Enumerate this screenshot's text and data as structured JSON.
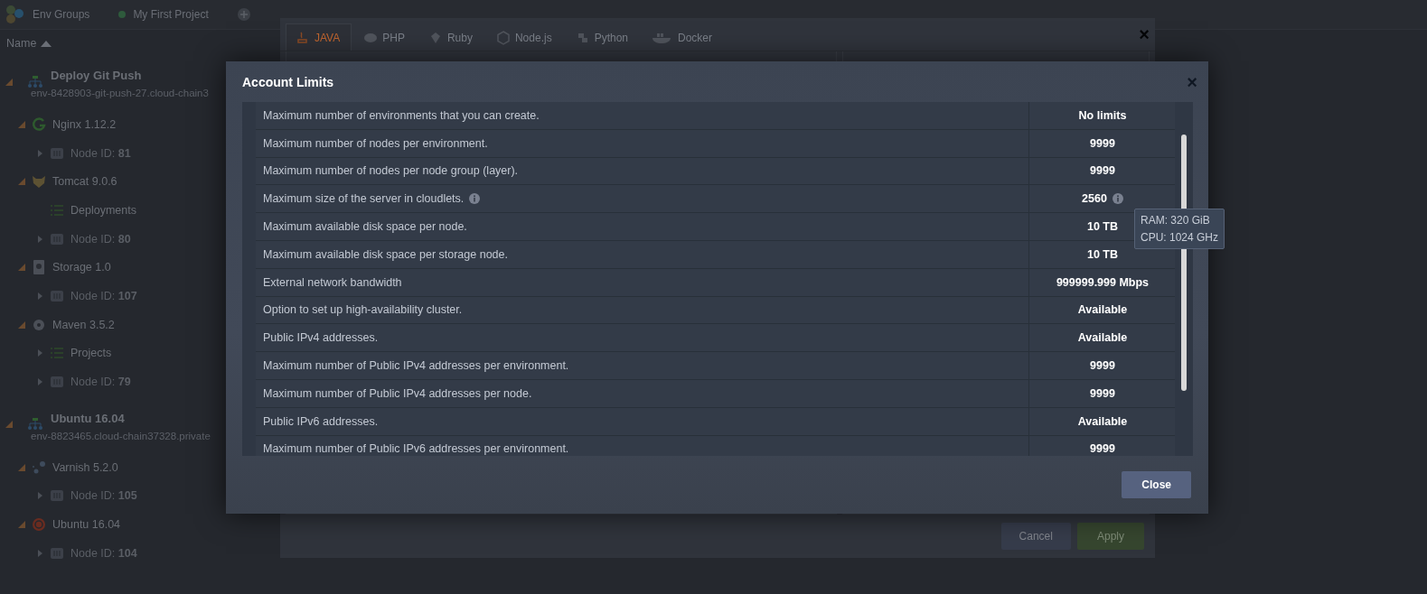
{
  "breadcrumbs": [
    {
      "label": "Env Groups",
      "kind": "groups"
    },
    {
      "label": "My First Project",
      "kind": "project"
    }
  ],
  "tree_header": {
    "label": "Name"
  },
  "tree": [
    {
      "label": "Deploy Git Push",
      "subtitle": "env-8428903-git-push-27.cloud-chain3",
      "kind": "env",
      "expanded": true,
      "children": [
        {
          "label": "Nginx 1.12.2",
          "kind": "nginx",
          "expanded": true,
          "children": [
            {
              "label": "Node ID: **81**",
              "kind": "node",
              "expanded": false
            }
          ]
        },
        {
          "label": "Tomcat 9.0.6",
          "kind": "tomcat",
          "expanded": true,
          "children": [
            {
              "label": "Deployments",
              "kind": "list"
            },
            {
              "label": "Node ID: **80**",
              "kind": "node",
              "expanded": false
            }
          ]
        },
        {
          "label": "Storage 1.0",
          "kind": "storage",
          "expanded": true,
          "children": [
            {
              "label": "Node ID: **107**",
              "kind": "node",
              "expanded": false
            }
          ]
        },
        {
          "label": "Maven 3.5.2",
          "kind": "maven",
          "expanded": true,
          "children": [
            {
              "label": "Projects",
              "kind": "list",
              "expanded": false
            },
            {
              "label": "Node ID: **79**",
              "kind": "node",
              "expanded": false
            }
          ]
        }
      ]
    },
    {
      "label": "Ubuntu 16.04",
      "subtitle": "env-8823465.cloud-chain37328.private",
      "kind": "env",
      "expanded": true,
      "children": [
        {
          "label": "Varnish 5.2.0",
          "kind": "varnish",
          "expanded": true,
          "children": [
            {
              "label": "Node ID: **105**",
              "kind": "node",
              "expanded": false
            }
          ]
        },
        {
          "label": "Ubuntu 16.04",
          "kind": "ubuntu",
          "expanded": true,
          "children": [
            {
              "label": "Node ID: **104**",
              "kind": "node",
              "expanded": false
            }
          ]
        }
      ]
    }
  ],
  "back_dialog": {
    "close": "×",
    "tabs": [
      {
        "label": "JAVA",
        "selected": true
      },
      {
        "label": "PHP",
        "selected": false
      },
      {
        "label": "Ruby",
        "selected": false
      },
      {
        "label": "Node.js",
        "selected": false
      },
      {
        "label": "Python",
        "selected": false
      },
      {
        "label": "Docker",
        "selected": false
      }
    ],
    "buttons": [
      {
        "label": "Cancel",
        "kind": "secondary"
      },
      {
        "label": "Apply",
        "kind": "primary"
      }
    ]
  },
  "modal": {
    "title": "Account Limits",
    "close": "×",
    "rows": [
      {
        "label": "Maximum number of environments that you can create.",
        "value": "No limits"
      },
      {
        "label": "Maximum number of nodes per environment.",
        "value": "9999"
      },
      {
        "label": "Maximum number of nodes per node group (layer).",
        "value": "9999"
      },
      {
        "label": "Maximum size of the server in cloudlets.",
        "value": "2560",
        "help": true,
        "info": true
      },
      {
        "label": "Maximum available disk space per node.",
        "value": "10 TB"
      },
      {
        "label": "Maximum available disk space per storage node.",
        "value": "10 TB"
      },
      {
        "label": "External network bandwidth",
        "value": "999999.999 Mbps"
      },
      {
        "label": "Option to set up high-availability cluster.",
        "value": "Available"
      },
      {
        "label": "Public IPv4 addresses.",
        "value": "Available"
      },
      {
        "label": "Maximum number of Public IPv4 addresses per environment.",
        "value": "9999"
      },
      {
        "label": "Maximum number of Public IPv4 addresses per node.",
        "value": "9999"
      },
      {
        "label": "Public IPv6 addresses.",
        "value": "Available"
      },
      {
        "label": "Maximum number of Public IPv6 addresses per environment.",
        "value": "9999"
      }
    ],
    "tooltip": [
      "RAM: 320 GiB",
      "CPU: 1024 GHz"
    ],
    "button": "Close"
  }
}
